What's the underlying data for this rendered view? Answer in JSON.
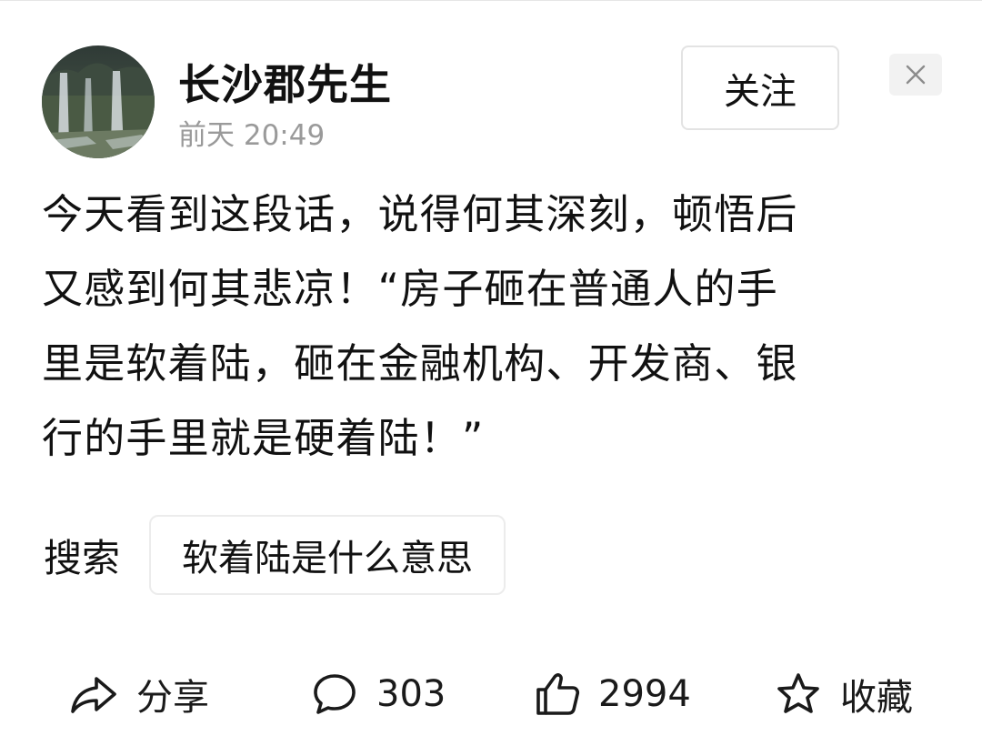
{
  "author": {
    "name": "长沙郡先生",
    "time": "前天  20:49",
    "avatar_icon": "waterfall-landscape-avatar"
  },
  "header": {
    "follow_label": "关注",
    "close_icon": "close-icon"
  },
  "post": {
    "lines": [
      "今天看到这段话，说得何其深刻，顿悟后",
      "又感到何其悲凉！“房子砸在普通人的手",
      "里是软着陆，砸在金融机构、开发商、银",
      "行的手里就是硬着陆！”"
    ]
  },
  "search": {
    "label": "搜索",
    "suggestion": "软着陆是什么意思"
  },
  "actions": {
    "share": {
      "icon": "share-icon",
      "label": "分享"
    },
    "comment": {
      "icon": "comment-icon",
      "label": "303"
    },
    "like": {
      "icon": "thumbs-up-icon",
      "label": "2994"
    },
    "favorite": {
      "icon": "star-icon",
      "label": "收藏"
    }
  },
  "colors": {
    "text": "#111111",
    "muted": "#9a9a9a",
    "border": "#e3e3e3"
  }
}
